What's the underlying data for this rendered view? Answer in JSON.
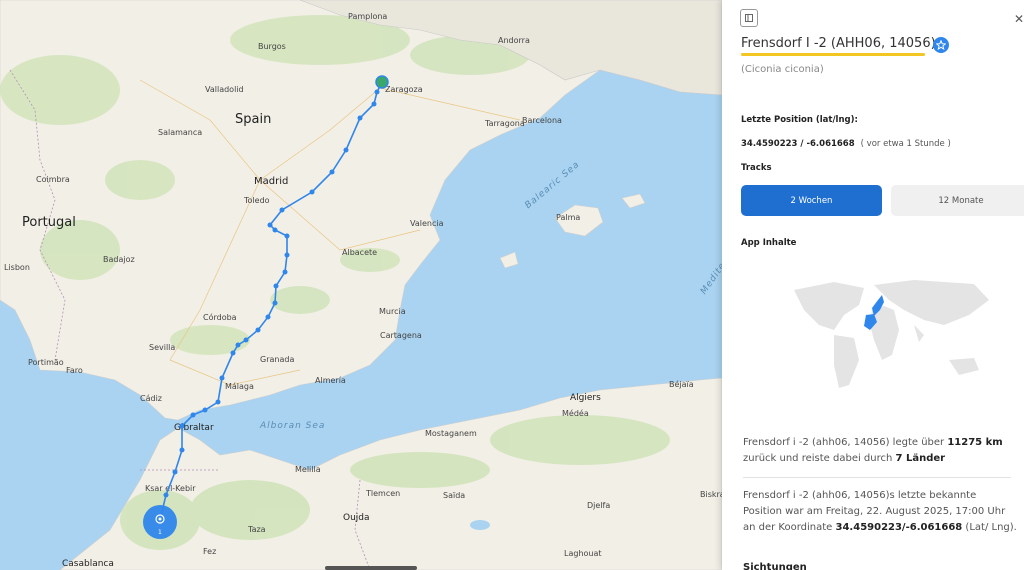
{
  "map": {
    "countries": {
      "spain": "Spain",
      "portugal": "Portugal"
    },
    "seas": {
      "balearic": "Balearic Sea",
      "alboran": "Alboran Sea",
      "mediterranean": "Mediterranean"
    },
    "cities": {
      "pamplona": "Pamplona",
      "burgos": "Burgos",
      "andorra": "Andorra",
      "valladolid": "Valladolid",
      "zaragoza": "Zaragoza",
      "salamanca": "Salamanca",
      "tarragona": "Tarragona",
      "barcelona": "Barcelona",
      "coimbra": "Coimbra",
      "madrid": "Madrid",
      "toledo": "Toledo",
      "valencia": "Valencia",
      "palma": "Palma",
      "lisbon": "Lisbon",
      "badajoz": "Badajoz",
      "albacete": "Albacete",
      "cordoba": "Córdoba",
      "murcia": "Murcia",
      "cartagena": "Cartagena",
      "sevilla": "Sevilla",
      "portimao": "Portimão",
      "faro": "Faro",
      "granada": "Granada",
      "almeria": "Almería",
      "bejaia": "Béjaïa",
      "malaga": "Málaga",
      "cadiz": "Cádiz",
      "algiers": "Algiers",
      "medea": "Médéa",
      "gibraltar": "Gibraltar",
      "mostaganem": "Mostaganem",
      "melilla": "Melilla",
      "ksar": "Ksar el-Kebir",
      "tlemcen": "Tlemcen",
      "saida": "Saïda",
      "djelfa": "Djelfa",
      "biskra": "Biskra",
      "oujda": "Oujda",
      "taza": "Taza",
      "fez": "Fez",
      "casablanca": "Casablanca",
      "laghouat": "Laghouat"
    },
    "cluster_count": "1"
  },
  "panel": {
    "title": "Frensdorf I -2 (AHH06, 14056)",
    "species": "(Ciconia ciconia)",
    "last_position_label": "Letzte Position (lat/lng):",
    "coordinates": "34.4590223 / -6.061668",
    "time_ago": "( vor etwa 1 Stunde )",
    "tracks_label": "Tracks",
    "track_2w": "2 Wochen",
    "track_12m": "12 Monate",
    "app_content_label": "App Inhalte",
    "stats": {
      "prefix": "Frensdorf i -2 (ahh06, 14056) legte über ",
      "distance": "11275 km",
      "middle": " zurück und reiste dabei durch ",
      "countries": "7 Länder"
    },
    "last_position_text": {
      "prefix": "Frensdorf i -2 (ahh06, 14056)s letzte bekannte Position war am Freitag, 22. August 2025, 17:00 Uhr an der Koordinate ",
      "coordinate": "34.4590223/-6.061668",
      "suffix": " (Lat/ Lng)."
    },
    "sightings_label": "Sichtungen"
  },
  "colors": {
    "track": "#2f86eb",
    "accent_button": "#1f6fd1",
    "underline": "#f3c623",
    "sea": "#a9d3f0",
    "land": "#f2efe6"
  }
}
